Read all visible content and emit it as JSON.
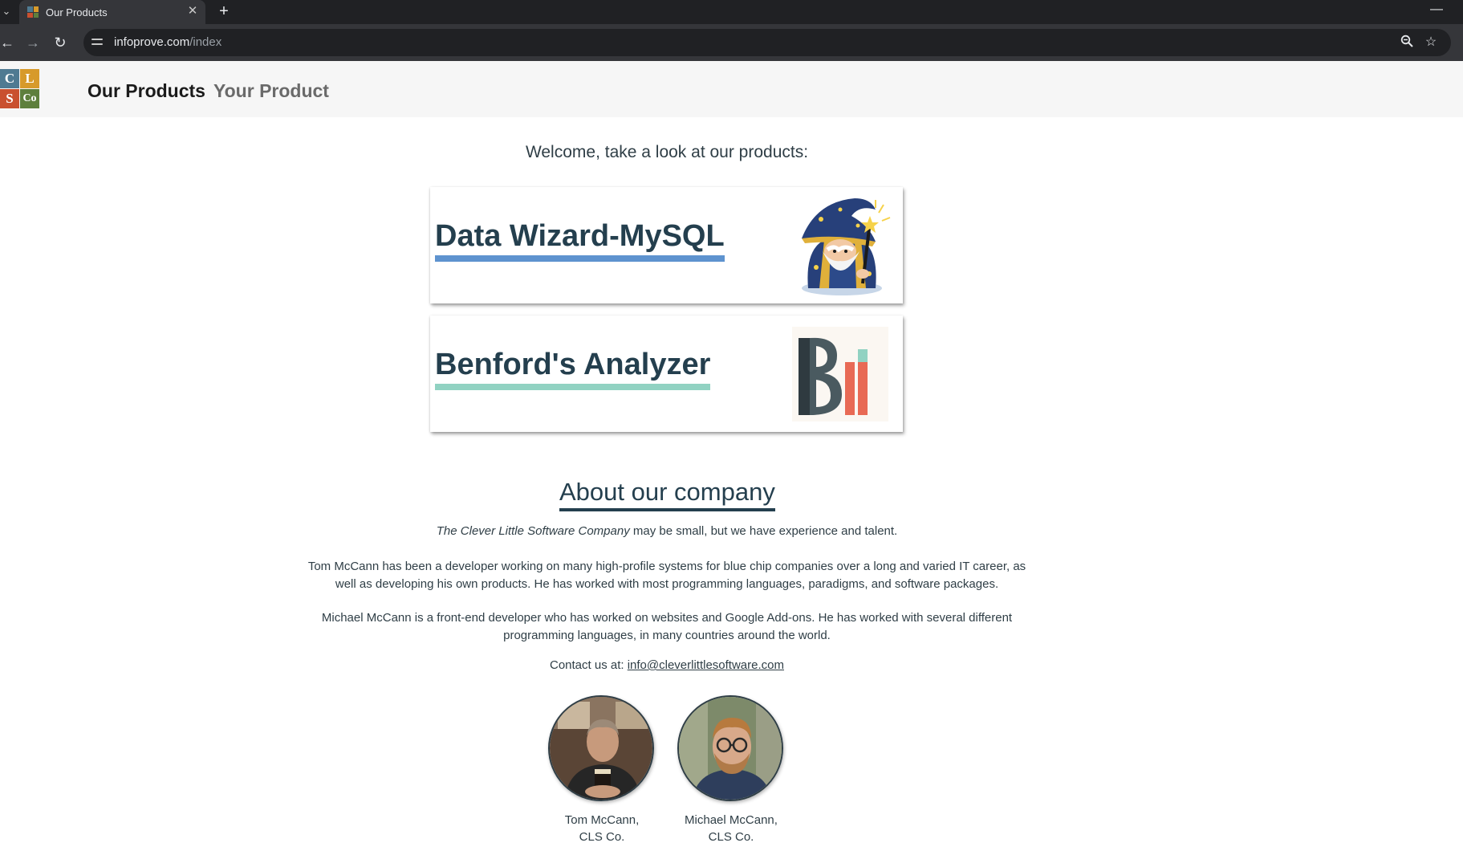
{
  "browser": {
    "tab_title": "Our Products",
    "tab_close_icon": "close-icon",
    "new_tab_icon": "plus-icon",
    "url_host": "infoprove.com",
    "url_path": "/index",
    "icons": [
      "back-arrow-icon",
      "forward-arrow-icon",
      "reload-icon",
      "site-settings-icon",
      "zoom-icon",
      "bookmark-star-icon",
      "minimize-icon"
    ]
  },
  "header": {
    "logo": {
      "letters": [
        "C",
        "L",
        "S",
        "Co"
      ],
      "colors": [
        "#4f7a92",
        "#d79a2b",
        "#c9502f",
        "#5e7f3d"
      ]
    },
    "nav": {
      "active": "Our Products",
      "inactive": "Your Product"
    }
  },
  "main": {
    "welcome": "Welcome, take a look at our products:",
    "products": [
      {
        "name": "Data Wizard-MySQL",
        "underline_color": "#5e93cf",
        "icon": "wizard-icon"
      },
      {
        "name": "Benford's Analyzer",
        "underline_color": "#91d2c2",
        "icon": "bar-chart-logo-icon"
      }
    ]
  },
  "about": {
    "heading": "About our company",
    "intro_italic": "The Clever Little Software Company",
    "intro_rest": " may be small, but we have experience and talent.",
    "tom_bio": "Tom McCann has been a developer working on many high-profile systems for blue chip companies over a long and varied IT career, as well as developing his own products. He has worked with most programming languages, paradigms, and software packages.",
    "michael_bio": "Michael McCann is a front-end developer who has worked on websites and Google Add-ons. He has worked with several different programming languages, in many countries around the world.",
    "contact_label": "Contact us at: ",
    "contact_email": "info@cleverlittlesoftware.com",
    "team": [
      {
        "name": "Tom McCann,",
        "company": "CLS Co."
      },
      {
        "name": "Michael McCann,",
        "company": "CLS Co."
      }
    ]
  }
}
